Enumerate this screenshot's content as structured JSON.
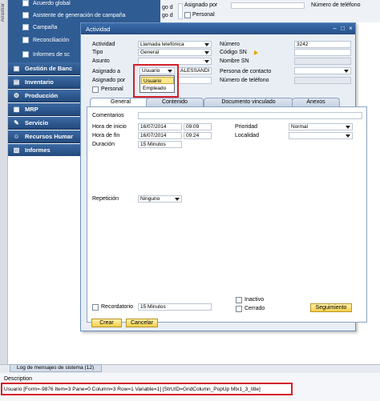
{
  "side_strip_label": "Arrastrar",
  "sidebar": {
    "subitems": [
      {
        "label": "Acuerdo global"
      },
      {
        "label": "Asistente de generación de campaña"
      },
      {
        "label": "Campaña"
      },
      {
        "label": "Reconciliación"
      },
      {
        "label": "Informes de sc"
      }
    ],
    "modules": [
      {
        "label": "Gestión de Banc",
        "icon": "bank-icon"
      },
      {
        "label": "Inventario",
        "icon": "inventory-icon"
      },
      {
        "label": "Producción",
        "icon": "production-icon"
      },
      {
        "label": "MRP",
        "icon": "mrp-icon"
      },
      {
        "label": "Servicio",
        "icon": "service-icon"
      },
      {
        "label": "Recursos Humar",
        "icon": "hr-icon"
      },
      {
        "label": "Informes",
        "icon": "reports-icon"
      }
    ]
  },
  "bg_form": {
    "go_label": "go d",
    "assigned_label": "Asignado por",
    "phone_label": "Número de teléfono",
    "personal_label": "Personal"
  },
  "dialog": {
    "title": "Actividad",
    "fields": {
      "actividad_label": "Actividad",
      "actividad_value": "Llamada telefónica",
      "tipo_label": "Tipo",
      "tipo_value": "General",
      "asunto_label": "Asunto",
      "asignado_a_label": "Asignado a",
      "asignado_a_value": "Usuario",
      "asignado_a_name": "ALESSANDI",
      "asignado_por_label": "Asignado por",
      "personal_label": "Personal",
      "numero_label": "Número",
      "numero_value": "3242",
      "codigo_sn_label": "Código SN",
      "nombre_sn_label": "Nombre SN",
      "persona_contacto_label": "Persona de contacto",
      "telefono_label": "Número de teléfono"
    },
    "dropdown_options": [
      "Usuario",
      "Empleado"
    ],
    "tabs": [
      {
        "label": "General"
      },
      {
        "label": "Contenido"
      },
      {
        "label": "Documento vinculado"
      },
      {
        "label": "Anexos"
      }
    ],
    "general": {
      "comentarios_label": "Comentarios",
      "hora_inicio_label": "Hora de inicio",
      "hora_inicio_date": "16/07/2014",
      "hora_inicio_time": "09:09",
      "hora_fin_label": "Hora de fin",
      "hora_fin_date": "16/07/2014",
      "hora_fin_time": "09:24",
      "duracion_label": "Duración",
      "duracion_value": "15 Minutos",
      "prioridad_label": "Prioridad",
      "prioridad_value": "Normal",
      "localidad_label": "Localidad",
      "repeticion_label": "Repetición",
      "repeticion_value": "Ninguno",
      "inactivo_label": "Inactivo",
      "cerrado_label": "Cerrado",
      "recordatorio_label": "Recordatorio",
      "recordatorio_value": "15 Minutos",
      "seguimiento_label": "Seguimiento"
    },
    "buttons": {
      "crear": "Crear",
      "cancelar": "Cancelar"
    }
  },
  "log_tab": "Log de mensajes de sistema (12)",
  "description_title": "Description",
  "description_text": "Usuario [Form=-9876 Item=3 Pane=0 Column=3 Row=1 Variable=1] [StrUID=GridColumn_PopUp Mtx1_3_title]"
}
